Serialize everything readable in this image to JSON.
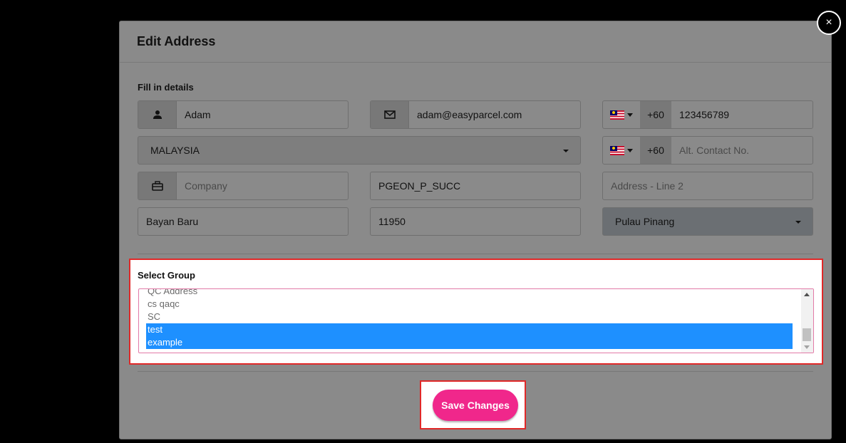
{
  "modal": {
    "title": "Edit Address",
    "close_label": "×"
  },
  "form": {
    "section_label": "Fill in details",
    "name": {
      "value": "Adam",
      "icon": "user-icon"
    },
    "email": {
      "value": "adam@easyparcel.com",
      "icon": "envelope-icon"
    },
    "phone": {
      "flag_icon": "malaysia-flag-icon",
      "code": "+60",
      "value": "123456789"
    },
    "country": {
      "value": "MALAYSIA"
    },
    "alt_phone": {
      "flag_icon": "malaysia-flag-icon",
      "code": "+60",
      "placeholder": "Alt. Contact No."
    },
    "company": {
      "placeholder": "Company",
      "icon": "briefcase-icon"
    },
    "address_line1": {
      "value": "PGEON_P_SUCC"
    },
    "address_line2": {
      "placeholder": "Address - Line 2"
    },
    "city": {
      "value": "Bayan Baru"
    },
    "postcode": {
      "value": "11950"
    },
    "state": {
      "value": "Pulau Pinang"
    }
  },
  "group": {
    "label": "Select Group",
    "options": [
      {
        "label": "QC Address",
        "selected": false
      },
      {
        "label": "cs qaqc",
        "selected": false
      },
      {
        "label": "SC",
        "selected": false
      },
      {
        "label": "test",
        "selected": true
      },
      {
        "label": "example",
        "selected": true
      }
    ]
  },
  "actions": {
    "save_label": "Save Changes"
  },
  "colors": {
    "accent": "#f0278b",
    "selection": "#1e90ff",
    "highlight_border": "#e02828"
  }
}
